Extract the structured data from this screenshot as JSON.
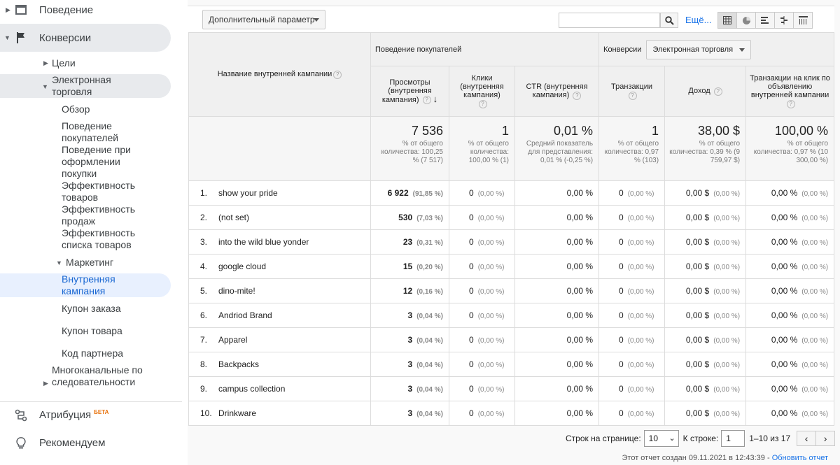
{
  "sidebar": {
    "behavior": "Поведение",
    "conversions": "Конверсии",
    "goals": "Цели",
    "ecommerce": "Электронная торговля",
    "overview": "Обзор",
    "shopping_behavior": "Поведение покупателей",
    "checkout_behavior": "Поведение при оформлении покупки",
    "product_perf": "Эффективность товаров",
    "sales_perf": "Эффективность продаж",
    "product_list_perf": "Эффективность списка товаров",
    "marketing": "Маркетинг",
    "internal_promo": "Внутренняя кампания",
    "order_coupon": "Купон заказа",
    "product_coupon": "Купон товара",
    "affiliate_code": "Код партнера",
    "multichannel": "Многоканальные последовательности",
    "attribution": "Атрибуция",
    "beta": "БЕТА",
    "discover": "Рекомендуем"
  },
  "toolbar": {
    "secondary_dimension": "Дополнительный параметр",
    "search_value": "",
    "more": "Ещё..."
  },
  "table": {
    "dimension_header": "Название внутренней кампании",
    "group_behavior": "Поведение покупателей",
    "group_conversions": "Конверсии",
    "conv_select": "Электронная торговля",
    "columns": [
      "Просмотры (внутренняя кампания)",
      "Клики (внутренняя кампания)",
      "CTR (внутренняя кампания)",
      "Транзакции",
      "Доход",
      "Транзакции на клик по объявлению внутренней кампании"
    ],
    "summary": [
      {
        "value": "7 536",
        "note": "% от общего количества: 100,25 % (7 517)"
      },
      {
        "value": "1",
        "note": "% от общего количества: 100,00 % (1)"
      },
      {
        "value": "0,01 %",
        "note": "Средний показатель для представления: 0,01 % (-0,25 %)"
      },
      {
        "value": "1",
        "note": "% от общего количества: 0,97 % (103)"
      },
      {
        "value": "38,00 $",
        "note": "% от общего количества: 0,39 % (9 759,97 $)"
      },
      {
        "value": "100,00 %",
        "note": "% от общего количества: 0,97 % (10 300,00 %)"
      }
    ],
    "rows": [
      {
        "idx": "1.",
        "name": "show your pride",
        "views": "6 922",
        "views_pct": "(91,85 %)"
      },
      {
        "idx": "2.",
        "name": "(not set)",
        "views": "530",
        "views_pct": "(7,03 %)"
      },
      {
        "idx": "3.",
        "name": "into the wild blue yonder",
        "views": "23",
        "views_pct": "(0,31 %)"
      },
      {
        "idx": "4.",
        "name": "google cloud",
        "views": "15",
        "views_pct": "(0,20 %)"
      },
      {
        "idx": "5.",
        "name": "dino-mite!",
        "views": "12",
        "views_pct": "(0,16 %)"
      },
      {
        "idx": "6.",
        "name": "Andriod Brand",
        "views": "3",
        "views_pct": "(0,04 %)"
      },
      {
        "idx": "7.",
        "name": "Apparel",
        "views": "3",
        "views_pct": "(0,04 %)"
      },
      {
        "idx": "8.",
        "name": "Backpacks",
        "views": "3",
        "views_pct": "(0,04 %)"
      },
      {
        "idx": "9.",
        "name": "campus collection",
        "views": "3",
        "views_pct": "(0,04 %)"
      },
      {
        "idx": "10.",
        "name": "Drinkware",
        "views": "3",
        "views_pct": "(0,04 %)"
      }
    ],
    "zero_clicks": "0",
    "zero_pct": "(0,00 %)",
    "zero_ctr": "0,00 %",
    "zero_tx": "0",
    "zero_rev": "0,00 $",
    "zero_tpc": "0,00 %"
  },
  "pager": {
    "rows_label": "Строк на странице:",
    "rows_value": "10",
    "goto_label": "К строке:",
    "goto_value": "1",
    "range": "1–10 из 17"
  },
  "footer": {
    "created": "Этот отчет создан 09.11.2021 в 12:43:39 -",
    "refresh": "Обновить отчет"
  }
}
